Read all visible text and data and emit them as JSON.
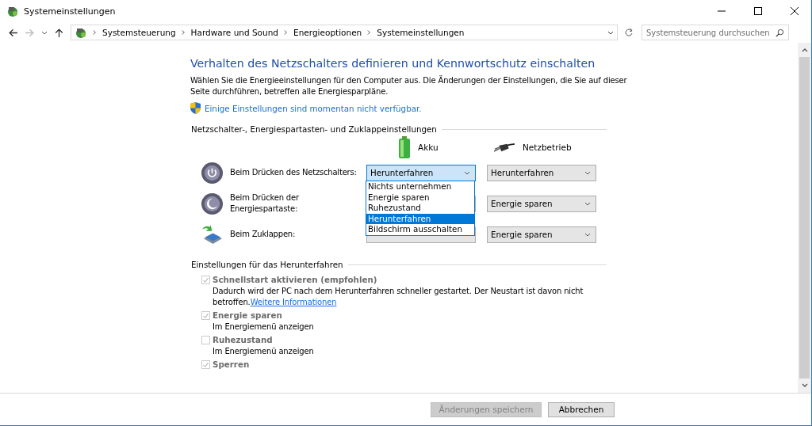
{
  "window": {
    "title": "Systemeinstellungen"
  },
  "address_bar": {
    "path": [
      "Systemsteuerung",
      "Hardware und Sound",
      "Energieoptionen",
      "Systemeinstellungen"
    ]
  },
  "search": {
    "placeholder": "Systemsteuerung durchsuchen"
  },
  "heading": "Verhalten des Netzschalters definieren und Kennwortschutz einschalten",
  "description": "Wählen Sie die Energieeinstellungen für den Computer aus. Die Änderungen der Einstellungen, die Sie auf dieser Seite durchführen, betreffen alle Energiesparpläne.",
  "notice_link": "Einige Einstellungen sind momentan nicht verfügbar.",
  "button_settings": {
    "title": "Netzschalter-, Energiespartasten- und Zuklappeinstellungen",
    "columns": [
      {
        "label": "Akku",
        "kind": "battery"
      },
      {
        "label": "Netzbetrieb",
        "kind": "plug"
      }
    ],
    "rows": [
      {
        "label": "Beim Drücken des Netzschalters:",
        "kind": "power",
        "battery_value": "Herunterfahren",
        "ac_value": "Herunterfahren",
        "focused": true
      },
      {
        "label": "Beim Drücken der Energiespartaste:",
        "kind": "sleep",
        "ac_value": "Energie sparen",
        "focused": false
      },
      {
        "label": "Beim Zuklappen:",
        "kind": "lid",
        "ac_value": "Energie sparen",
        "focused": false
      }
    ],
    "open_dropdown": {
      "options": [
        {
          "label": "Nichts unternehmen",
          "selected": false
        },
        {
          "label": "Energie sparen",
          "selected": false
        },
        {
          "label": "Ruhezustand",
          "selected": false
        },
        {
          "label": "Herunterfahren",
          "selected": true
        },
        {
          "label": "Bildschirm ausschalten",
          "selected": false
        }
      ]
    }
  },
  "shutdown_settings": {
    "title": "Einstellungen für das Herunterfahren",
    "options": [
      {
        "label": "Schnellstart aktivieren (empfohlen)",
        "checked": true,
        "disabled": true,
        "description": "Dadurch wird der PC nach dem Herunterfahren schneller gestartet. Der Neustart ist davon nicht betroffen.",
        "link": "Weitere Informationen"
      },
      {
        "label": "Energie sparen",
        "checked": true,
        "disabled": true,
        "description": "Im Energiemenü anzeigen"
      },
      {
        "label": "Ruhezustand",
        "checked": false,
        "disabled": true,
        "description": "Im Energiemenü anzeigen"
      },
      {
        "label": "Sperren",
        "checked": true,
        "disabled": true
      }
    ]
  },
  "buttons": [
    {
      "label": "Änderungen speichern",
      "disabled": true
    },
    {
      "label": "Abbrechen",
      "disabled": false
    }
  ]
}
